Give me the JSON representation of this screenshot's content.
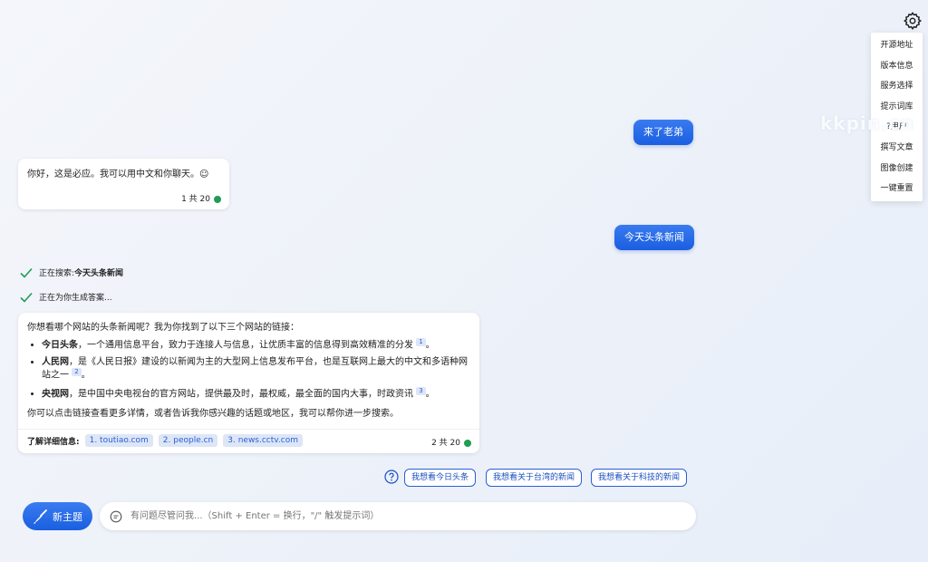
{
  "settings_menu": {
    "items": [
      "开源地址",
      "版本信息",
      "服务选择",
      "提示词库",
      "?用户",
      "撰写文章",
      "图像创建",
      "一键重置"
    ]
  },
  "watermark": "kkpin.cn",
  "messages": {
    "user1": "来了老弟",
    "bot1": {
      "text": "你好，这是必应。我可以用中文和你聊天。☺",
      "count": "1 共 20"
    },
    "user2": "今天头条新闻",
    "status1_prefix": "正在搜索: ",
    "status1_query": "今天头条新闻",
    "status2": "正在为你生成答案...",
    "bot2": {
      "intro": "你想看哪个网站的头条新闻呢？我为你找到了以下三个网站的链接：",
      "items": [
        {
          "name": "今日头条",
          "desc": "，一个通用信息平台，致力于连接人与信息，让优质丰富的信息得到高效精准的分发",
          "ref": "1"
        },
        {
          "name": "人民网",
          "desc": "，是《人民日报》建设的以新闻为主的大型网上信息发布平台，也是互联网上最大的中文和多语种网站之一",
          "ref": "2"
        },
        {
          "name": "央视网",
          "desc": "，是中国中央电视台的官方网站，提供最及时，最权威，最全面的国内大事，时政资讯",
          "ref": "3"
        }
      ],
      "outro": "你可以点击链接查看更多详情，或者告诉我你感兴趣的话题或地区，我可以帮你进一步搜索。",
      "learn_more": "了解详细信息:",
      "links": [
        "1. toutiao.com",
        "2. people.cn",
        "3. news.cctv.com"
      ],
      "count": "2 共 20"
    }
  },
  "suggestions": [
    "我想看今日头条",
    "我想看关于台湾的新闻",
    "我想看关于科技的新闻"
  ],
  "new_topic_label": "新主题",
  "input_placeholder": "有问题尽管问我...（Shift + Enter = 换行，\"/\" 触发提示词）",
  "colors": {
    "accent": "#1a5fe0",
    "status_dot": "#1f9d55"
  }
}
